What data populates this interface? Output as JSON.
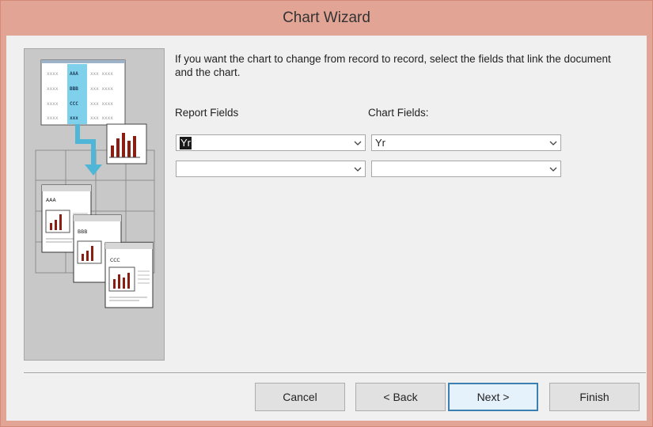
{
  "window": {
    "title": "Chart Wizard"
  },
  "illustration": {
    "datasheet_cells": [
      "AAA",
      "BBB",
      "CCC"
    ],
    "report_labels": [
      "AAA",
      "BBB",
      "CCC"
    ]
  },
  "instructions": "If you want the chart to change from record to record, select the fields that link the document and the chart.",
  "report_fields": {
    "label": "Report Fields",
    "values": [
      "Yr",
      ""
    ]
  },
  "chart_fields": {
    "label": "Chart Fields:",
    "values": [
      "Yr",
      ""
    ]
  },
  "buttons": {
    "cancel": "Cancel",
    "back": "< Back",
    "next": "Next >",
    "finish": "Finish"
  },
  "icons": {
    "dropdown": "chevron-down-icon"
  },
  "colors": {
    "title_bar": "#e2a595",
    "illustration_arrow": "#4fb6d8",
    "chart_bar": "#8b1e12"
  }
}
